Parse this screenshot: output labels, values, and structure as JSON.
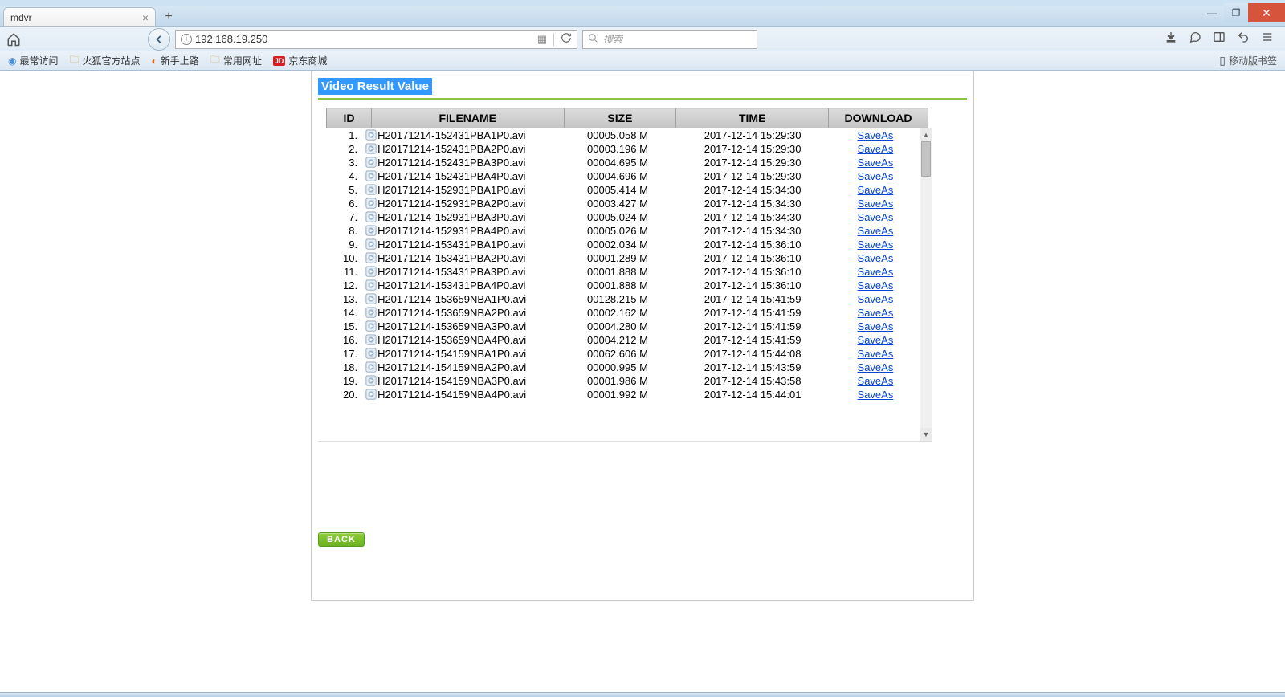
{
  "browser": {
    "tab_title": "mdvr",
    "url": "192.168.19.250",
    "search_placeholder": "搜索",
    "bookmarks": {
      "b1": "最常访问",
      "b2": "火狐官方站点",
      "b3": "新手上路",
      "b4": "常用网址",
      "b5": "京东商城",
      "mobile": "移动版书签"
    }
  },
  "page": {
    "heading": "Video Result Value",
    "headers": {
      "id": "ID",
      "filename": "FILENAME",
      "size": "SIZE",
      "time": "TIME",
      "download": "DOWNLOAD"
    },
    "save_label": "SaveAs",
    "back_label": "BACK",
    "rows": [
      {
        "id": "1.",
        "fn": "H20171214-152431PBA1P0.avi",
        "size": "00005.058 M",
        "time": "2017-12-14 15:29:30"
      },
      {
        "id": "2.",
        "fn": "H20171214-152431PBA2P0.avi",
        "size": "00003.196 M",
        "time": "2017-12-14 15:29:30"
      },
      {
        "id": "3.",
        "fn": "H20171214-152431PBA3P0.avi",
        "size": "00004.695 M",
        "time": "2017-12-14 15:29:30"
      },
      {
        "id": "4.",
        "fn": "H20171214-152431PBA4P0.avi",
        "size": "00004.696 M",
        "time": "2017-12-14 15:29:30"
      },
      {
        "id": "5.",
        "fn": "H20171214-152931PBA1P0.avi",
        "size": "00005.414 M",
        "time": "2017-12-14 15:34:30"
      },
      {
        "id": "6.",
        "fn": "H20171214-152931PBA2P0.avi",
        "size": "00003.427 M",
        "time": "2017-12-14 15:34:30"
      },
      {
        "id": "7.",
        "fn": "H20171214-152931PBA3P0.avi",
        "size": "00005.024 M",
        "time": "2017-12-14 15:34:30"
      },
      {
        "id": "8.",
        "fn": "H20171214-152931PBA4P0.avi",
        "size": "00005.026 M",
        "time": "2017-12-14 15:34:30"
      },
      {
        "id": "9.",
        "fn": "H20171214-153431PBA1P0.avi",
        "size": "00002.034 M",
        "time": "2017-12-14 15:36:10"
      },
      {
        "id": "10.",
        "fn": "H20171214-153431PBA2P0.avi",
        "size": "00001.289 M",
        "time": "2017-12-14 15:36:10"
      },
      {
        "id": "11.",
        "fn": "H20171214-153431PBA3P0.avi",
        "size": "00001.888 M",
        "time": "2017-12-14 15:36:10"
      },
      {
        "id": "12.",
        "fn": "H20171214-153431PBA4P0.avi",
        "size": "00001.888 M",
        "time": "2017-12-14 15:36:10"
      },
      {
        "id": "13.",
        "fn": "H20171214-153659NBA1P0.avi",
        "size": "00128.215 M",
        "time": "2017-12-14 15:41:59"
      },
      {
        "id": "14.",
        "fn": "H20171214-153659NBA2P0.avi",
        "size": "00002.162 M",
        "time": "2017-12-14 15:41:59"
      },
      {
        "id": "15.",
        "fn": "H20171214-153659NBA3P0.avi",
        "size": "00004.280 M",
        "time": "2017-12-14 15:41:59"
      },
      {
        "id": "16.",
        "fn": "H20171214-153659NBA4P0.avi",
        "size": "00004.212 M",
        "time": "2017-12-14 15:41:59"
      },
      {
        "id": "17.",
        "fn": "H20171214-154159NBA1P0.avi",
        "size": "00062.606 M",
        "time": "2017-12-14 15:44:08"
      },
      {
        "id": "18.",
        "fn": "H20171214-154159NBA2P0.avi",
        "size": "00000.995 M",
        "time": "2017-12-14 15:43:59"
      },
      {
        "id": "19.",
        "fn": "H20171214-154159NBA3P0.avi",
        "size": "00001.986 M",
        "time": "2017-12-14 15:43:58"
      },
      {
        "id": "20.",
        "fn": "H20171214-154159NBA4P0.avi",
        "size": "00001.992 M",
        "time": "2017-12-14 15:44:01"
      }
    ]
  }
}
